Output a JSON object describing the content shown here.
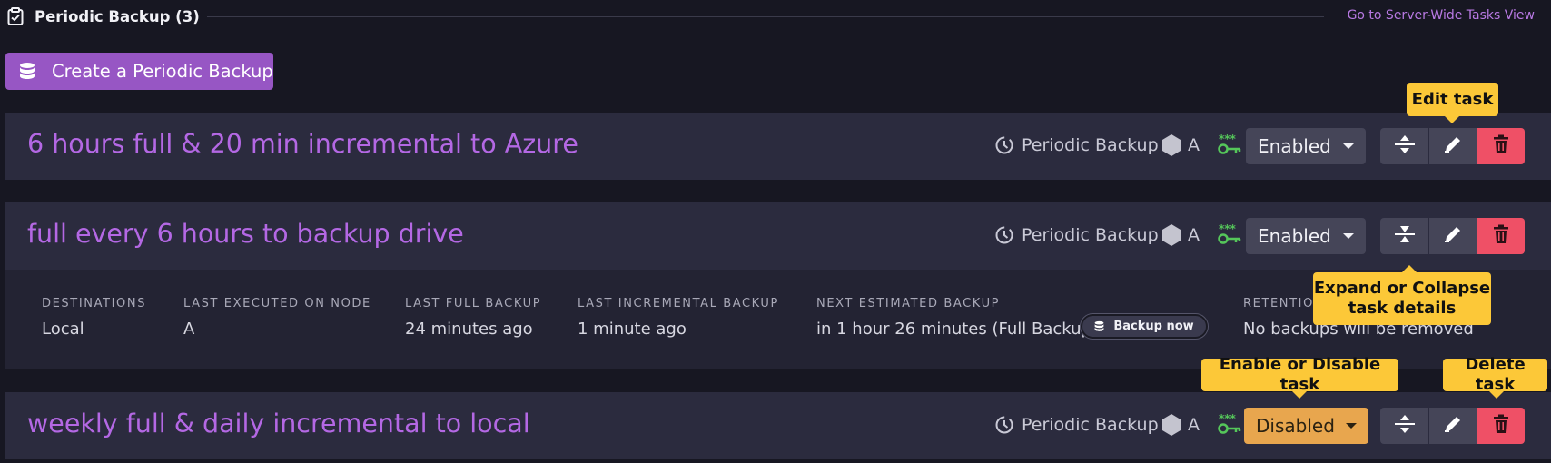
{
  "header": {
    "title": "Periodic Backup (3)",
    "server_link": "Go to Server-Wide Tasks View"
  },
  "create_button": {
    "label": "Create a Periodic Backup"
  },
  "tasks": [
    {
      "name": "6 hours full & 20 min incremental to Azure",
      "type": "Periodic Backup",
      "node": "A",
      "state": "Enabled"
    },
    {
      "name": "full every 6 hours to backup drive",
      "type": "Periodic Backup",
      "node": "A",
      "state": "Enabled",
      "details": {
        "destinations_label": "DESTINATIONS",
        "destinations": "Local",
        "last_executed_label": "LAST EXECUTED ON NODE",
        "last_executed": "A",
        "last_full_label": "LAST FULL BACKUP",
        "last_full": "24 minutes ago",
        "last_incremental_label": "LAST INCREMENTAL BACKUP",
        "last_incremental": "1 minute ago",
        "next_label": "NEXT ESTIMATED BACKUP",
        "next": "in 1 hour 26 minutes (Full Backup)",
        "backup_now": "Backup now",
        "retention_label": "RETENTIO",
        "retention": "No backups will be removed"
      }
    },
    {
      "name": "weekly full & daily incremental to local",
      "type": "Periodic Backup",
      "node": "A",
      "state": "Disabled"
    }
  ],
  "tooltips": {
    "edit": "Edit task",
    "expand": "Expand or Collapse task details",
    "expand_line1": "Expand or Collapse",
    "expand_line2": "task details",
    "enable": "Enable or Disable task",
    "delete": "Delete task"
  },
  "colors": {
    "accent": "#9756c4",
    "task_name": "#b468e4",
    "enabled_bg": "#454558",
    "disabled_bg": "#e8a64e",
    "delete_bg": "#ef5066",
    "tooltip_bg": "#fcc838",
    "key_icon": "#55c65a"
  },
  "icons": {
    "header": "clipboard-task-icon",
    "create": "database-stack-icon",
    "type": "periodic-backup-icon",
    "node": "hexagon-node-icon",
    "key": "encryption-key-icon",
    "expand": "expand-collapse-icon",
    "edit": "pencil-icon",
    "delete": "trash-icon"
  }
}
